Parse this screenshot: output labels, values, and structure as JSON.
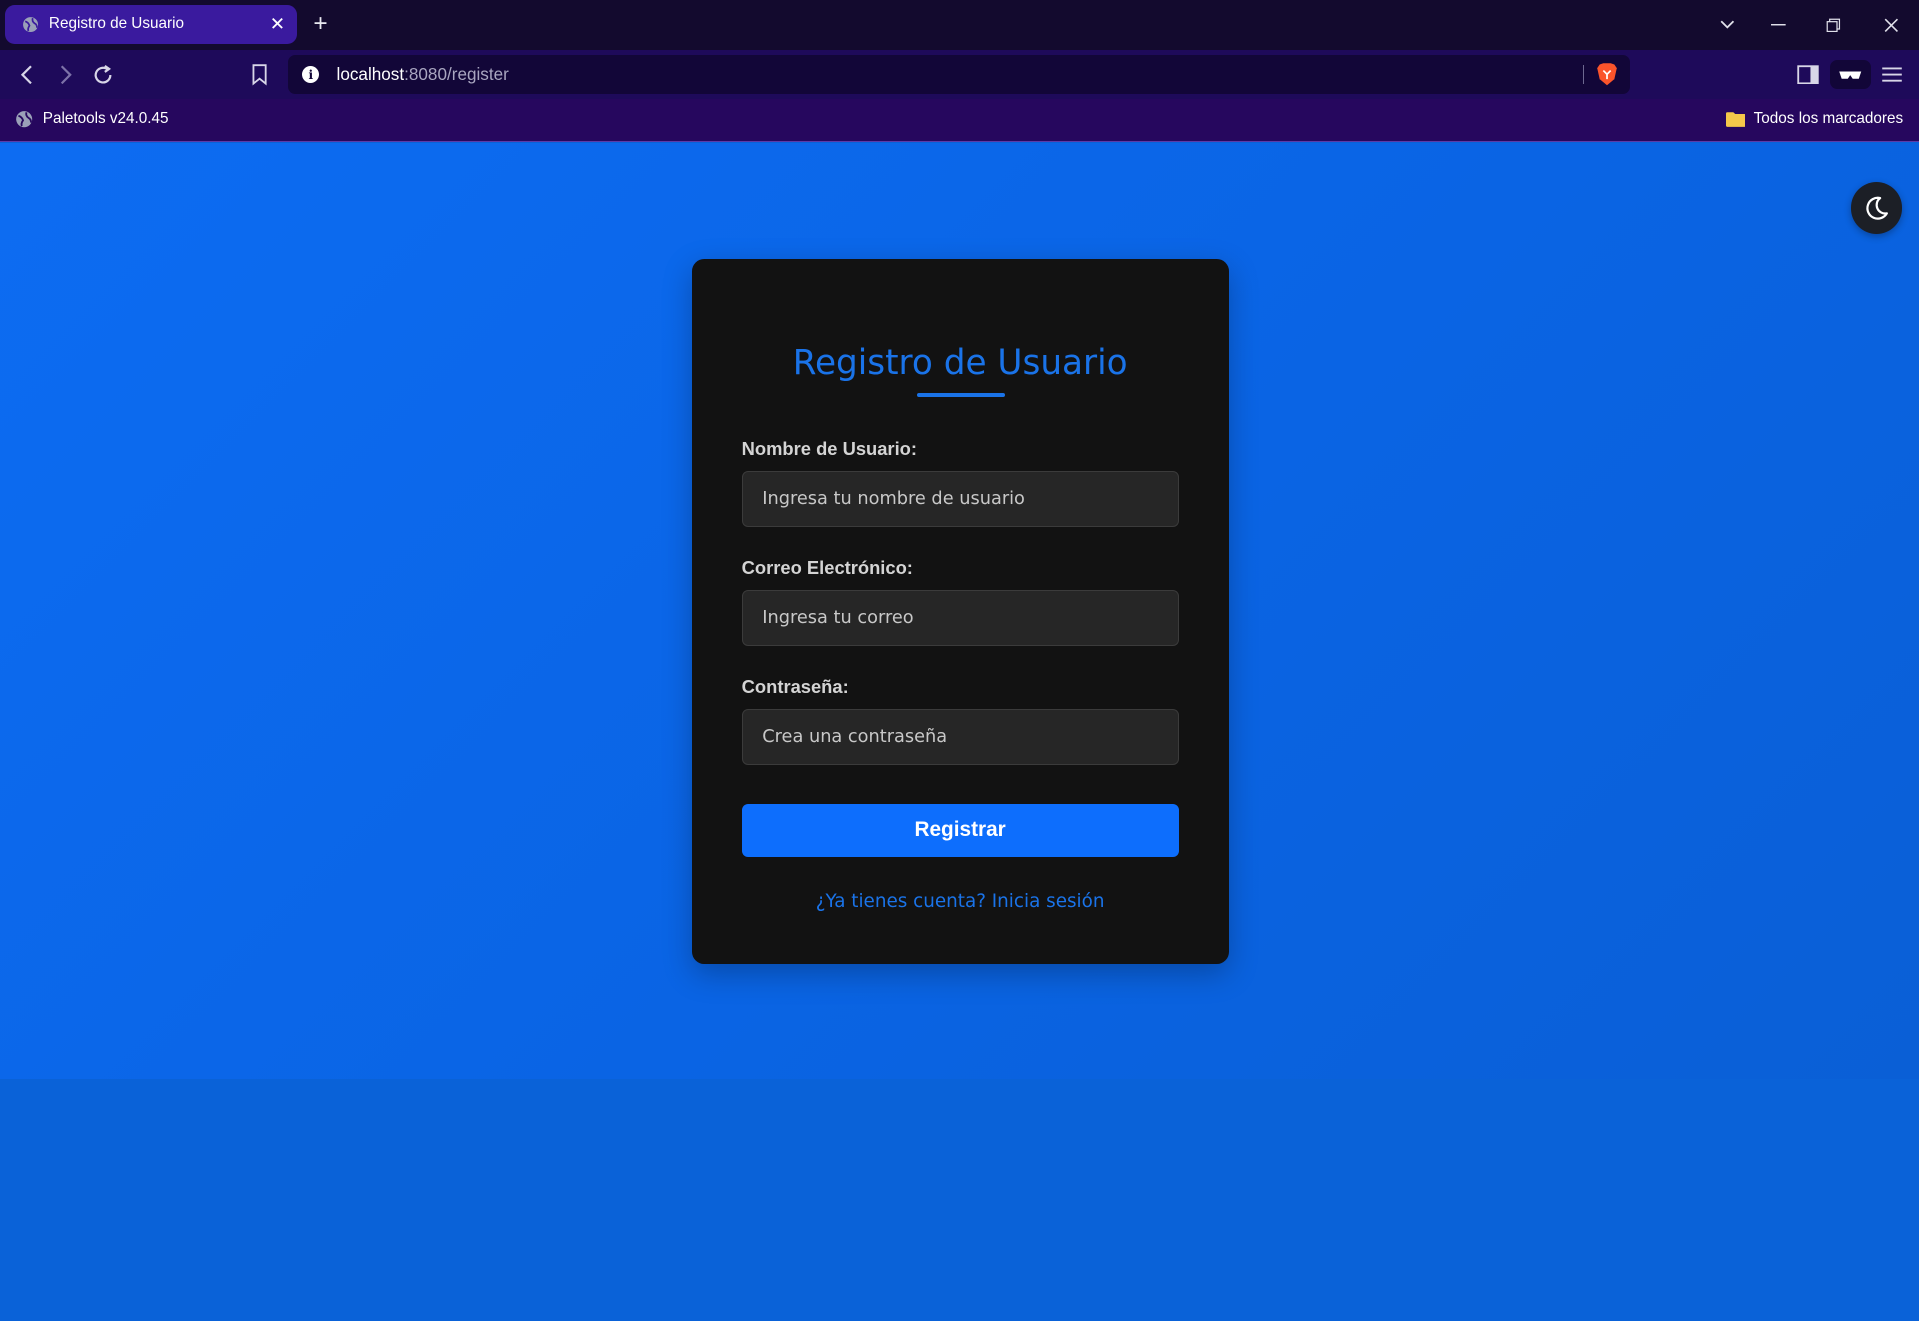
{
  "browser": {
    "tab_title": "Registro de Usuario",
    "tab_close": "✕",
    "new_tab": "+",
    "url_host": "localhost",
    "url_path": ":8080/register",
    "bookmark_left": "Paletools v24.0.45",
    "bookmark_right": "Todos los marcadores"
  },
  "form": {
    "title": "Registro de Usuario",
    "username_label": "Nombre de Usuario:",
    "username_placeholder": "Ingresa tu nombre de usuario",
    "email_label": "Correo Electrónico:",
    "email_placeholder": "Ingresa tu correo",
    "password_label": "Contraseña:",
    "password_placeholder": "Crea una contraseña",
    "submit_label": "Registrar",
    "login_link": "¿Ya tienes cuenta? Inicia sesión"
  },
  "colors": {
    "accent": "#1a73e8",
    "button": "#0d6efd",
    "card_bg": "#121212",
    "page_bg": "#0a64e4"
  }
}
